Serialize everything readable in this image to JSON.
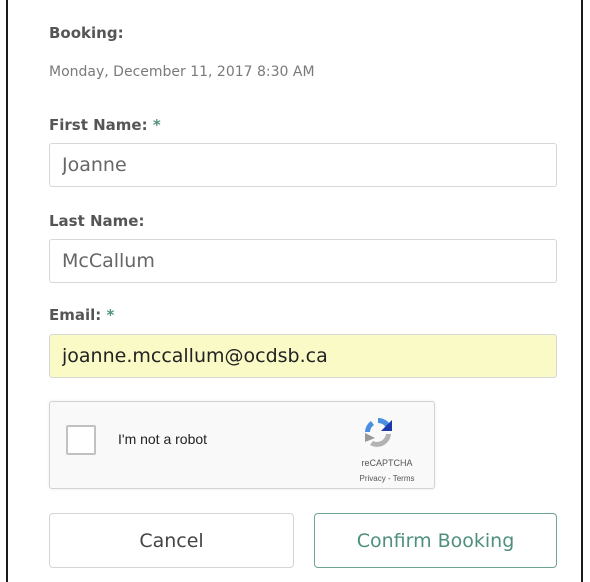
{
  "booking": {
    "label": "Booking:",
    "datetime": "Monday, December 11, 2017 8:30 AM"
  },
  "form": {
    "first_name": {
      "label": "First Name:",
      "required_mark": "*",
      "value": "Joanne"
    },
    "last_name": {
      "label": "Last Name:",
      "value": "McCallum"
    },
    "email": {
      "label": "Email:",
      "required_mark": "*",
      "value": "joanne.mccallum@ocdsb.ca"
    }
  },
  "captcha": {
    "checkbox_label": "I'm not a robot",
    "brand": "reCAPTCHA",
    "links": "Privacy - Terms",
    "checked": false
  },
  "actions": {
    "cancel_label": "Cancel",
    "confirm_label": "Confirm Booking"
  },
  "colors": {
    "accent": "#4f8f7e",
    "autofill_bg": "#fafac6",
    "border": "#d7d7d7"
  }
}
